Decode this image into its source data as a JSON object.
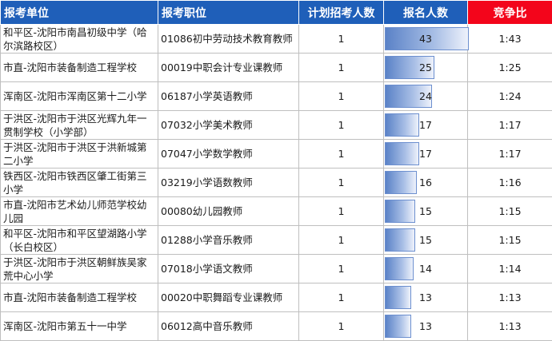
{
  "headers": {
    "unit": "报考单位",
    "position": "报考职位",
    "plan": "计划招考人数",
    "applicants": "报名人数",
    "ratio": "竞争比"
  },
  "colors": {
    "header_blue": "#1f5fb9",
    "header_red": "#f3051b",
    "bar_fill": "#5a82c7"
  },
  "max_applicants": 43,
  "rows": [
    {
      "unit": "和平区-沈阳市南昌初级中学（哈尔滨路校区）",
      "position": "01086初中劳动技术教育教师",
      "plan": "1",
      "applicants": "43",
      "applicants_num": 43,
      "ratio": "1:43"
    },
    {
      "unit": "市直-沈阳市装备制造工程学校",
      "position": "00019中职会计专业课教师",
      "plan": "1",
      "applicants": "25",
      "applicants_num": 25,
      "ratio": "1:25"
    },
    {
      "unit": "浑南区-沈阳市浑南区第十二小学",
      "position": "06187小学英语教师",
      "plan": "1",
      "applicants": "24",
      "applicants_num": 24,
      "ratio": "1:24"
    },
    {
      "unit": "于洪区-沈阳市于洪区光辉九年一贯制学校（小学部）",
      "position": "07032小学美术教师",
      "plan": "1",
      "applicants": "17",
      "applicants_num": 17,
      "ratio": "1:17"
    },
    {
      "unit": "于洪区-沈阳市于洪区于洪新城第二小学",
      "position": "07047小学数学教师",
      "plan": "1",
      "applicants": "17",
      "applicants_num": 17,
      "ratio": "1:17"
    },
    {
      "unit": "铁西区-沈阳市铁西区肇工街第三小学",
      "position": "03219小学语数教师",
      "plan": "1",
      "applicants": "16",
      "applicants_num": 16,
      "ratio": "1:16"
    },
    {
      "unit": "市直-沈阳市艺术幼儿师范学校幼儿园",
      "position": "00080幼儿园教师",
      "plan": "1",
      "applicants": "15",
      "applicants_num": 15,
      "ratio": "1:15"
    },
    {
      "unit": "和平区-沈阳市和平区望湖路小学（长白校区）",
      "position": "01288小学音乐教师",
      "plan": "1",
      "applicants": "15",
      "applicants_num": 15,
      "ratio": "1:15"
    },
    {
      "unit": "于洪区-沈阳市于洪区朝鲜族吴家荒中心小学",
      "position": "07018小学语文教师",
      "plan": "1",
      "applicants": "14",
      "applicants_num": 14,
      "ratio": "1:14"
    },
    {
      "unit": "市直-沈阳市装备制造工程学校",
      "position": "00020中职舞蹈专业课教师",
      "plan": "1",
      "applicants": "13",
      "applicants_num": 13,
      "ratio": "1:13"
    },
    {
      "unit": "浑南区-沈阳市第五十一中学",
      "position": "06012高中音乐教师",
      "plan": "1",
      "applicants": "13",
      "applicants_num": 13,
      "ratio": "1:13"
    }
  ]
}
